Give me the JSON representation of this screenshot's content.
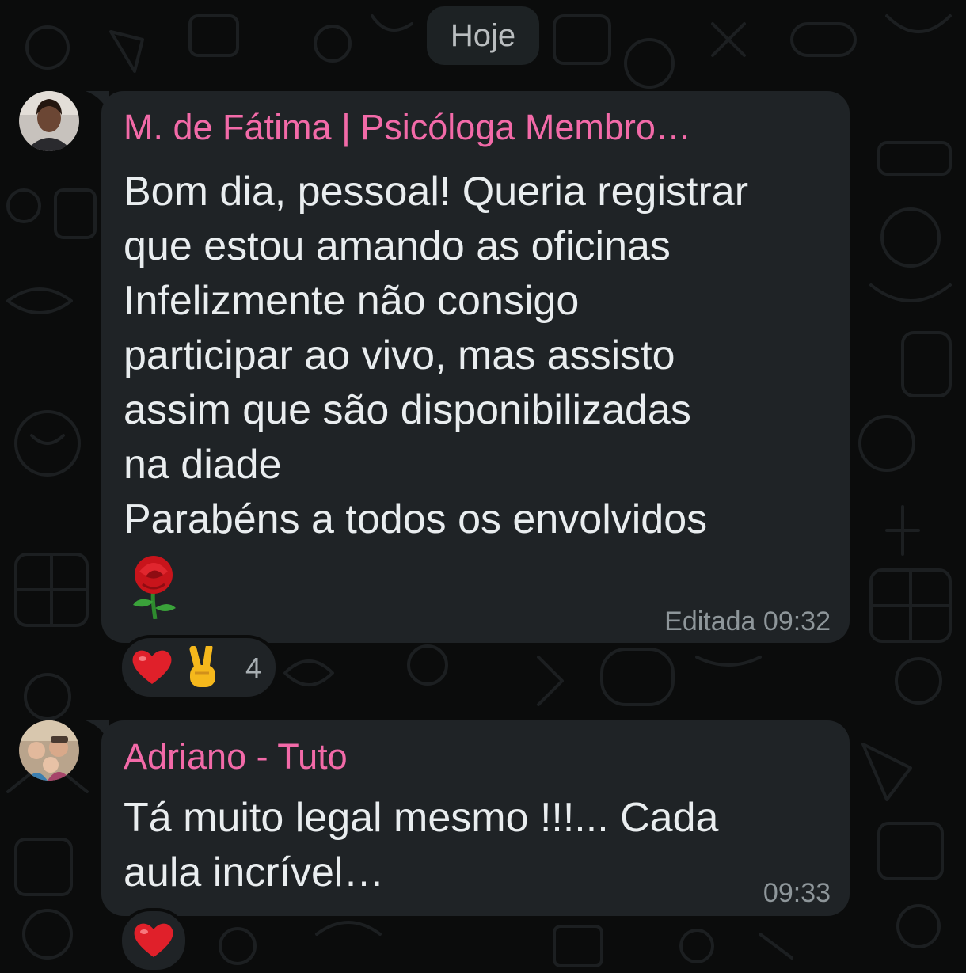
{
  "date_separator": "Hoje",
  "messages": [
    {
      "sender": "M. de Fátima | Psicóloga Membro…",
      "text": "Bom dia, pessoal! Queria registrar\nque estou amando as oficinas\nInfelizmente não consigo\nparticipar ao vivo, mas assisto\nassim que são disponibilizadas\nna diade\nParabéns a todos os envolvidos",
      "emoji": "rose",
      "meta": "Editada 09:32",
      "reactions": {
        "emojis": [
          "heart",
          "victory-hand"
        ],
        "count": "4"
      }
    },
    {
      "sender": "Adriano - Tuto",
      "text": "Tá muito legal mesmo !!!... Cada\naula incrível…",
      "meta": "09:33",
      "reactions": {
        "emojis": [
          "heart"
        ]
      }
    }
  ],
  "colors": {
    "background": "#0b0c0c",
    "bubble": "#1f2326",
    "sender_name": "#f26aa8",
    "message_text": "#e9edef",
    "meta_text": "#8e969a"
  }
}
